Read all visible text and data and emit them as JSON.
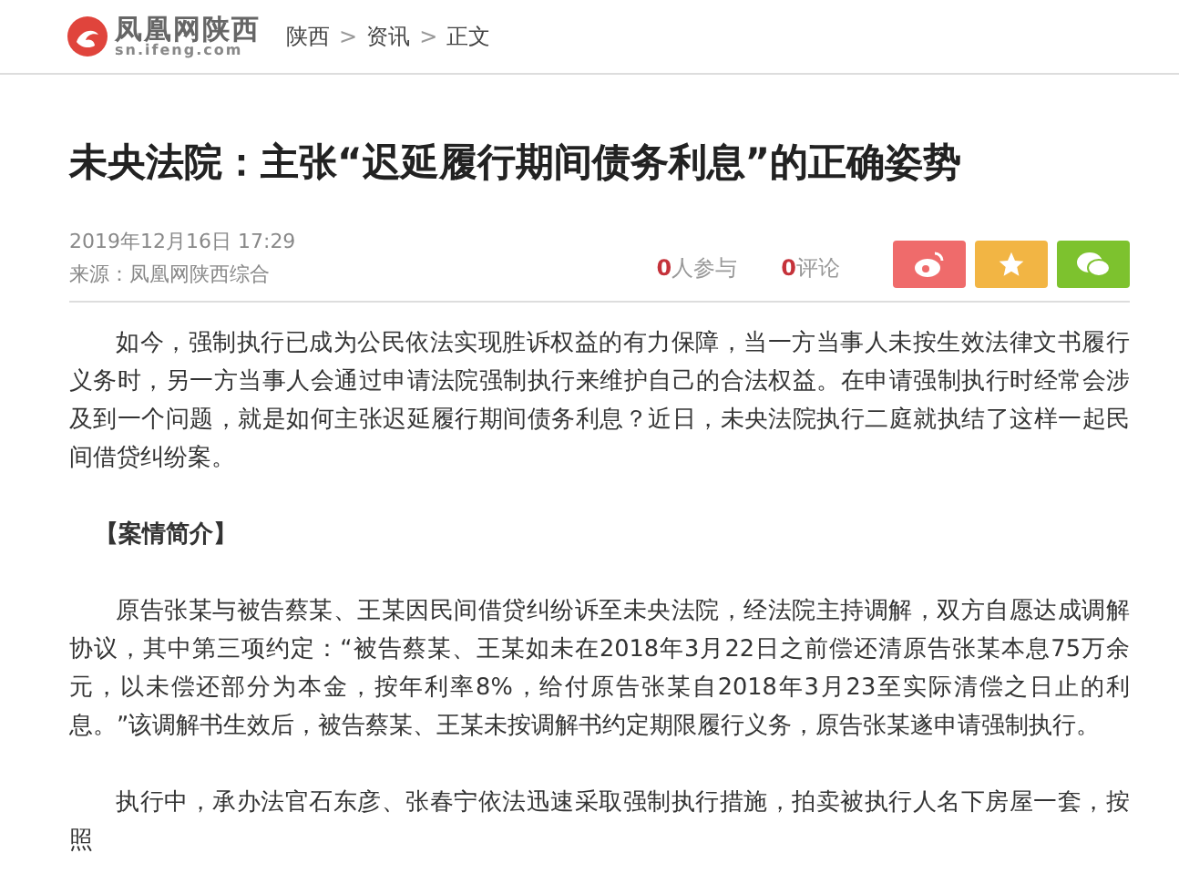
{
  "header": {
    "site_name": "凤凰网陕西",
    "site_url": "sn.ifeng.com",
    "breadcrumb": [
      {
        "kind": "link",
        "text": "陕西"
      },
      {
        "kind": "separator",
        "text": ">"
      },
      {
        "kind": "link",
        "text": "资讯"
      },
      {
        "kind": "separator",
        "text": ">"
      },
      {
        "kind": "current",
        "text": "正文"
      }
    ]
  },
  "article": {
    "title": "未央法院：主张“迟延履行期间债务利息”的正确姿势",
    "date": "2019年12月16日  17:29",
    "source": "来源：凤凰网陕西综合",
    "stats": [
      {
        "count": "0",
        "label": "人参与"
      },
      {
        "count": "0",
        "label": "评论"
      }
    ],
    "share_buttons": [
      {
        "kind": "weibo",
        "color": "#ef6b6b"
      },
      {
        "kind": "favorite",
        "color": "#f2b544"
      },
      {
        "kind": "wechat",
        "color": "#7dc22e"
      }
    ],
    "body": [
      {
        "kind": "paragraph",
        "text": "如今，强制执行已成为公民依法实现胜诉权益的有力保障，当一方当事人未按生效法律文书履行义务时，另一方当事人会通过申请法院强制执行来维护自己的合法权益。在申请强制执行时经常会涉及到一个问题，就是如何主张迟延履行期间债务利息？近日，未央法院执行二庭就执结了这样一起民间借贷纠纷案。"
      },
      {
        "kind": "heading",
        "text": "【案情简介】"
      },
      {
        "kind": "paragraph",
        "text": "原告张某与被告蔡某、王某因民间借贷纠纷诉至未央法院，经法院主持调解，双方自愿达成调解协议，其中第三项约定：“被告蔡某、王某如未在2018年3月22日之前偿还清原告张某本息75万余元，以未偿还部分为本金，按年利率8%，给付原告张某自2018年3月23至实际清偿之日止的利息。”该调解书生效后，被告蔡某、王某未按调解书约定期限履行义务，原告张某遂申请强制执行。"
      },
      {
        "kind": "paragraph",
        "text": "执行中，承办法官石东彦、张春宁依法迅速采取强制执行措施，拍卖被执行人名下房屋一套，按照"
      }
    ]
  }
}
